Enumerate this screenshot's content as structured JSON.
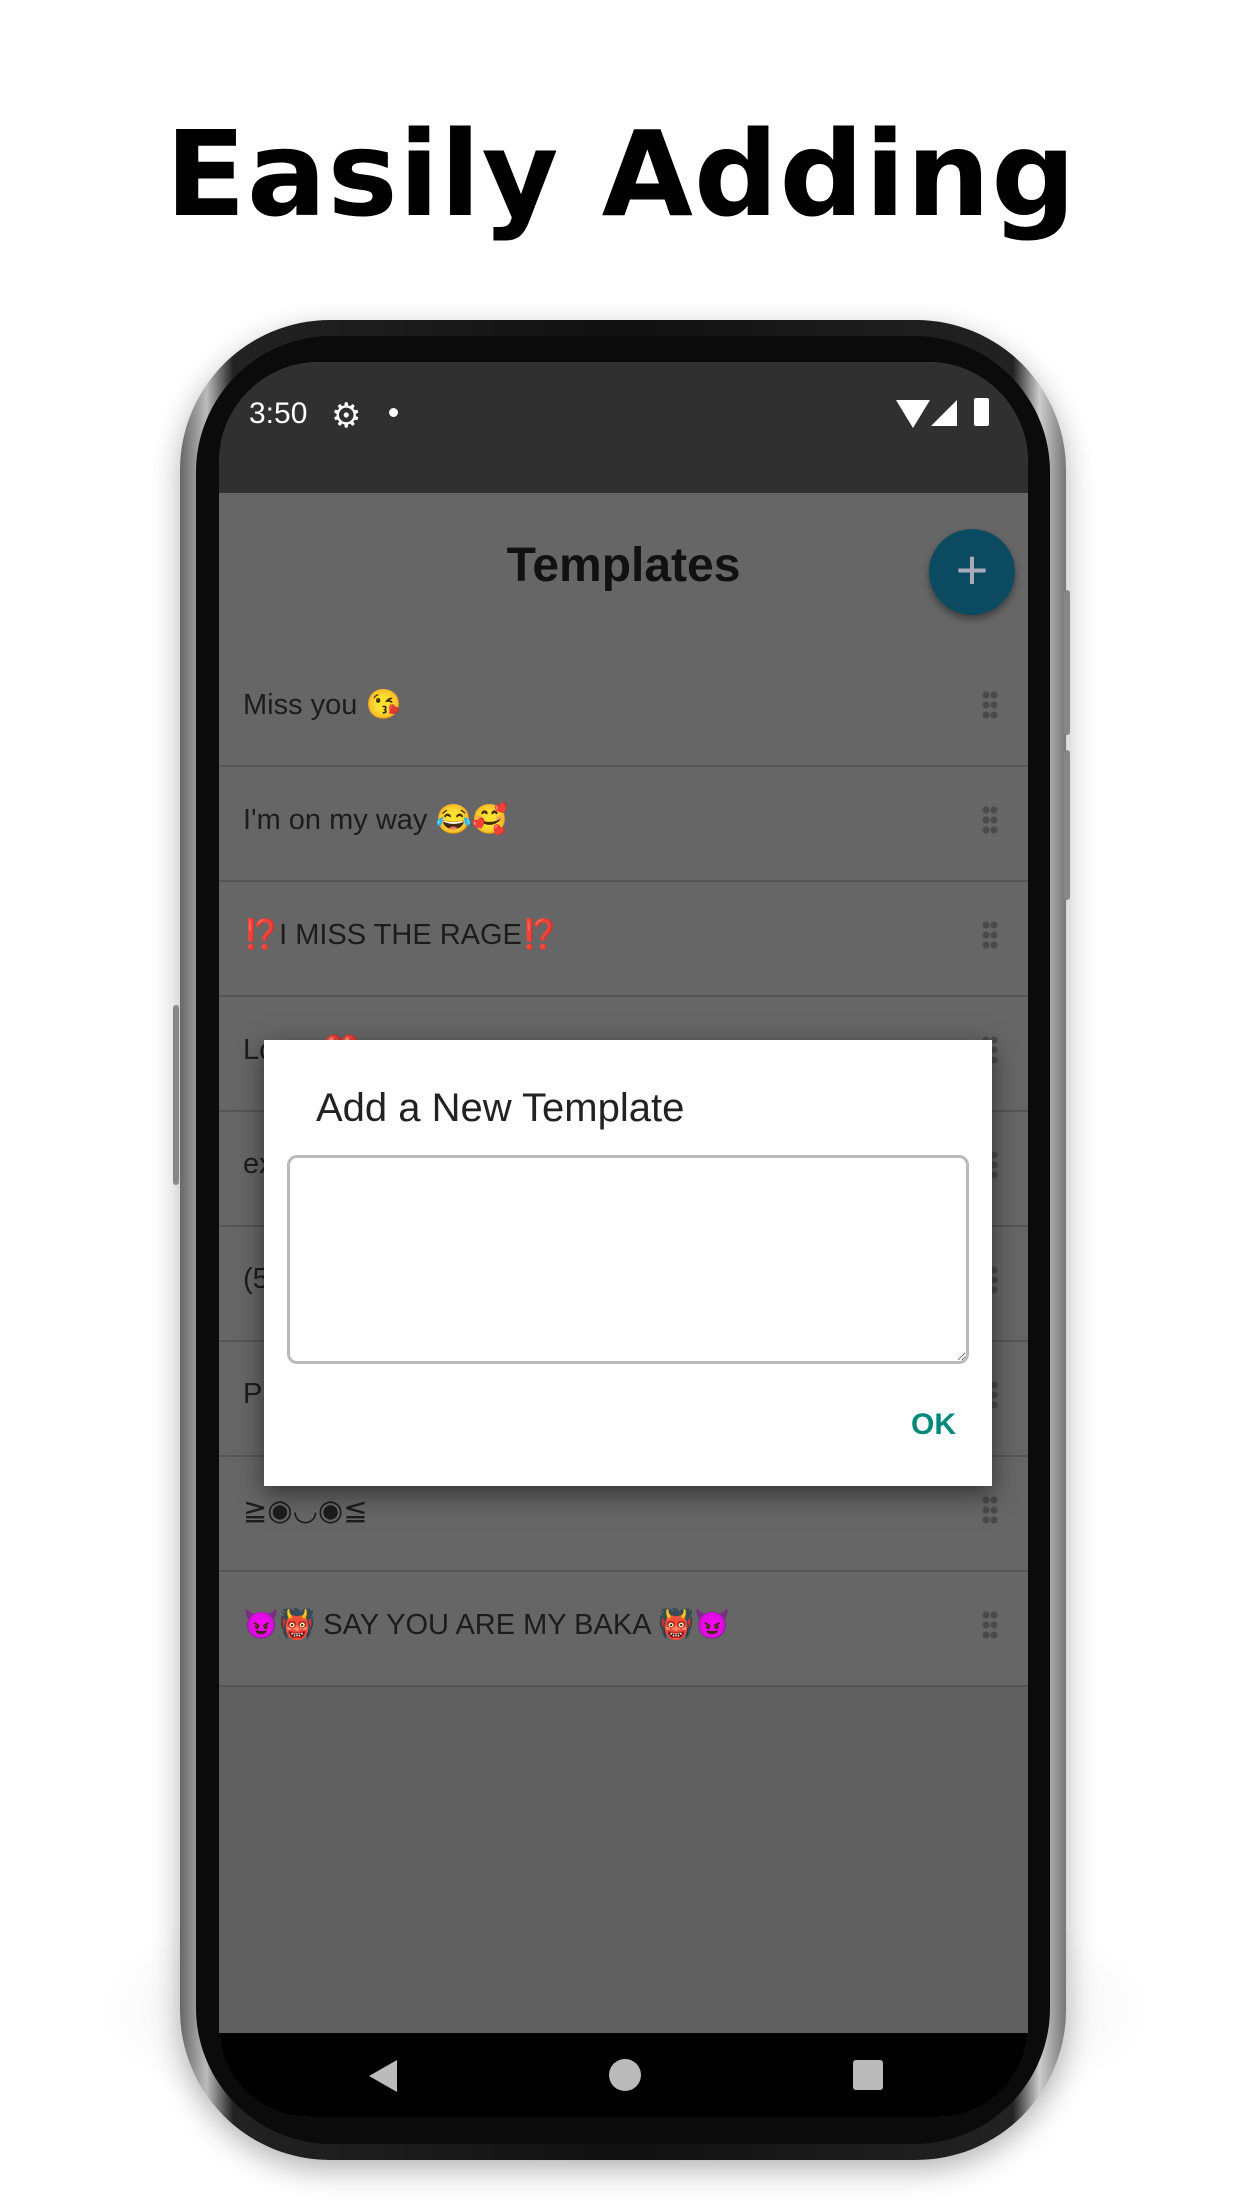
{
  "headline": "Easily Adding",
  "status_bar": {
    "time": "3:50",
    "icons": [
      "gear-icon",
      "notification-dot",
      "wifi-icon",
      "signal-icon",
      "battery-icon"
    ]
  },
  "app": {
    "title": "Templates",
    "fab_label": "+",
    "accent": "#0e7a9e"
  },
  "templates": [
    {
      "text": "Miss you 😘"
    },
    {
      "text": "I'm on my way 😂🥰"
    },
    {
      "text": "⁉️I MISS THE RAGE⁉️"
    },
    {
      "text": "Lo      ❤️"
    },
    {
      "text": "ex"
    },
    {
      "text": "(5"
    },
    {
      "text": "P"
    },
    {
      "text": "≧◉◡◉≦"
    },
    {
      "text": "😈👹 SAY YOU ARE MY BAKA 👹😈"
    }
  ],
  "dialog": {
    "title": "Add a New Template",
    "input_value": "",
    "ok_label": "OK",
    "ok_color": "#00897b"
  }
}
